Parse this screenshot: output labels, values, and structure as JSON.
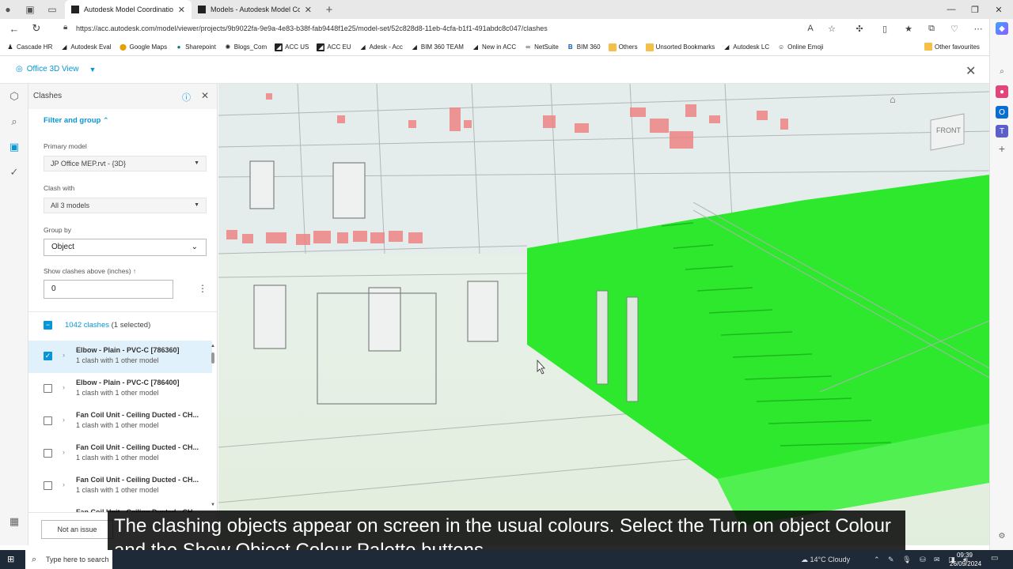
{
  "browser": {
    "tabs": [
      {
        "label": "Autodesk Model Coordination",
        "active": true
      },
      {
        "label": "Models - Autodesk Model Coordi",
        "active": false
      }
    ],
    "url": "https://acc.autodesk.com/model/viewer/projects/9b9022fa-9e9a-4e83-b38f-fab9448f1e25/model-set/52c828d8-11eb-4cfa-b1f1-491abdc8c047/clashes",
    "bookmarks": [
      "Cascade HR",
      "Autodesk Eval",
      "Google Maps",
      "Sharepoint",
      "Blogs_Com",
      "ACC US",
      "ACC EU",
      "Adesk - Acc",
      "BIM 360 TEAM",
      "New in ACC",
      "NetSuite",
      "BIM 360",
      "Others",
      "Unsorted Bookmarks",
      "Autodesk LC",
      "Online Emoji"
    ],
    "other_favourites": "Other favourites"
  },
  "app": {
    "view_name": "Office 3D View"
  },
  "panel": {
    "title": "Clashes",
    "filter_group": "Filter and group",
    "primary_model_label": "Primary model",
    "primary_model_value": "JP Office MEP.rvt - {3D}",
    "clash_with_label": "Clash with",
    "clash_with_value": "All 3 models",
    "group_by_label": "Group by",
    "group_by_value": "Object",
    "threshold_label": "Show clashes above (inches) ↑",
    "threshold_value": "0",
    "clash_count": "1042 clashes",
    "selected_count": "(1 selected)",
    "rows": [
      {
        "title": "Elbow - Plain - PVC-C [786360]",
        "sub": "1 clash with 1 other model",
        "checked": true
      },
      {
        "title": "Elbow - Plain - PVC-C [786400]",
        "sub": "1 clash with 1 other model",
        "checked": false
      },
      {
        "title": "Fan Coil Unit - Ceiling Ducted - CH...",
        "sub": "1 clash with 1 other model",
        "checked": false
      },
      {
        "title": "Fan Coil Unit - Ceiling Ducted - CH...",
        "sub": "1 clash with 1 other model",
        "checked": false
      },
      {
        "title": "Fan Coil Unit - Ceiling Ducted - CH...",
        "sub": "1 clash with 1 other model",
        "checked": false
      },
      {
        "title": "Fan Coil Unit - Ceiling Ducted - CH...",
        "sub": "",
        "checked": false
      }
    ],
    "not_issue_label": "Not an issue"
  },
  "viewcube": {
    "face": "FRONT"
  },
  "caption": "The clashing objects appear on screen in the usual colours. Select the Turn on object Colour and the Show Object Colour Palette buttons.",
  "taskbar": {
    "search_placeholder": "Type here to search",
    "weather": "14°C  Cloudy",
    "time": "09:39",
    "date": "26/09/2024"
  },
  "colors": {
    "accent": "#0696d7",
    "clash_green": "#2ee82e",
    "clash_red": "#ee6b6b"
  }
}
